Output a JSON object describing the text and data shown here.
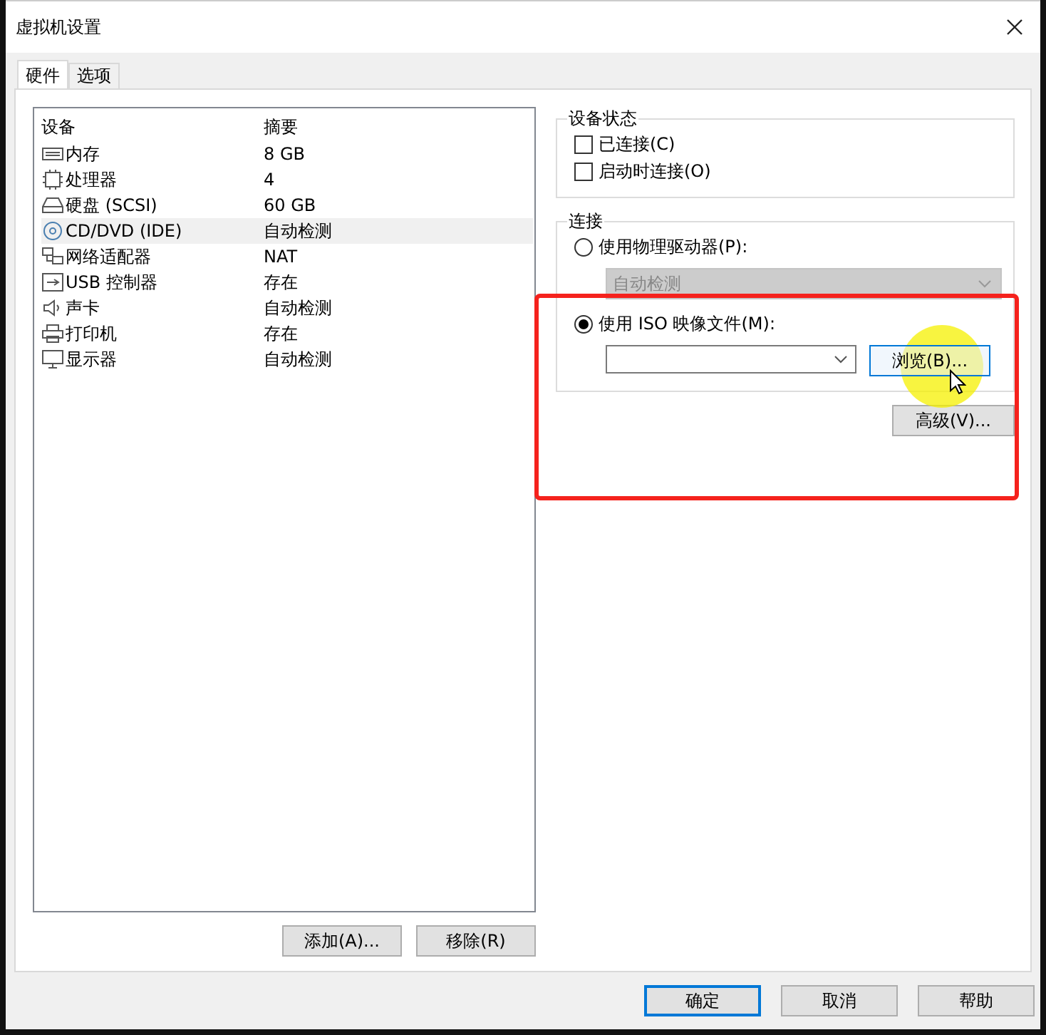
{
  "window": {
    "title": "虚拟机设置"
  },
  "tabs": [
    {
      "label": "硬件",
      "selected": true
    },
    {
      "label": "选项",
      "selected": false
    }
  ],
  "devices": {
    "columns": [
      "设备",
      "摘要"
    ],
    "rows": [
      {
        "kind": "memory",
        "name": "内存",
        "summary": "8 GB",
        "selected": false
      },
      {
        "kind": "cpu",
        "name": "处理器",
        "summary": "4",
        "selected": false
      },
      {
        "kind": "disk",
        "name": "硬盘 (SCSI)",
        "summary": "60 GB",
        "selected": false
      },
      {
        "kind": "cd",
        "name": "CD/DVD (IDE)",
        "summary": "自动检测",
        "selected": true
      },
      {
        "kind": "network",
        "name": "网络适配器",
        "summary": "NAT",
        "selected": false
      },
      {
        "kind": "usb",
        "name": "USB 控制器",
        "summary": "存在",
        "selected": false
      },
      {
        "kind": "sound",
        "name": "声卡",
        "summary": "自动检测",
        "selected": false
      },
      {
        "kind": "printer",
        "name": "打印机",
        "summary": "存在",
        "selected": false
      },
      {
        "kind": "display",
        "name": "显示器",
        "summary": "自动检测",
        "selected": false
      }
    ]
  },
  "list_buttons": [
    "添加(A)...",
    "移除(R)"
  ],
  "device_status": {
    "title": "设备状态",
    "options": [
      {
        "label": "已连接(C)",
        "checked": false
      },
      {
        "label": "启动时连接(O)",
        "checked": false
      }
    ]
  },
  "connection": {
    "title": "连接",
    "physical": {
      "label": "使用物理驱动器(P):",
      "selected": false,
      "dropdown": {
        "value": "自动检测",
        "disabled": true
      }
    },
    "iso": {
      "label": "使用 ISO 映像文件(M):",
      "selected": true,
      "browse": "浏览(B)..."
    }
  },
  "advanced_button": "高级(V)...",
  "footer_buttons": [
    {
      "label": "确定",
      "default": true
    },
    {
      "label": "取消",
      "default": false
    },
    {
      "label": "帮助",
      "default": false
    }
  ]
}
